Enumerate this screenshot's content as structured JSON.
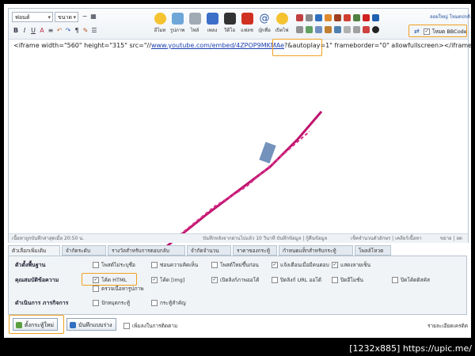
{
  "toolbar": {
    "font_select": "ฟอนต์",
    "size_select": "ขนาด",
    "big_buttons": [
      "อีโมท",
      "รูปภาพ",
      "ไฟล์",
      "เพลง",
      "วีดีโอ",
      "แฟลช",
      "@เพื่อ",
      "เปิดไฟ"
    ],
    "right_link_top": "ลอยใหญ่ โหมดปกติ",
    "bbcode_label": "โหมด BBCode"
  },
  "editor": {
    "code_prefix": "<iframe width=\"560\" height=\"315\" src=\"//",
    "code_link": "www.youtube.com/embed/4ZPOP9MKMAe",
    "code_param": "?&autoplay=1",
    "code_suffix": "\" frameborder=\"0\" allowfullscreen></iframe>",
    "status_left": "เนื้อหาถูกบันทึกล่าสุดเมื่อ 20:50 น.",
    "status_mid": "บันทึกหลังจากผ่านไปแล้ว 10 วินาที บันทึกข้อมูล | กู้คืนข้อมูล",
    "status_right": "เช็คจำนวนตัวอักษร | เคลียร์เนื้อหา",
    "status_size": "ขยาย | ลด"
  },
  "tabs": [
    "ตัวเลือกเพิ่มเติม",
    "จำกัดระดับ",
    "รางวัลสำหรับการตอบกลับ",
    "จำกัดจำนวน",
    "ราคาของกระทู้",
    "กำหนดแท็กสำหรับกระทู้",
    "โพลล์โหวต"
  ],
  "options": {
    "row1_label": "ตัวตั้งพื้นฐาน",
    "row1": [
      "โพสต์ไม่ระบุชื่อ",
      "ซ่อนความคิดเห็น",
      "โพสต์ใหม่ขึ้นก่อน",
      "แจ้งเตือนเมื่อมีคนตอบ",
      "แสดงลายเซ็น"
    ],
    "row2_label": "คุณสมบัติข้อความ",
    "row2": [
      "โค้ด HTML",
      "โค้ด [img]",
      "เปิดลิงก์ภาพออโต้",
      "ปิดลิงก์ URL ออโต้",
      "ปิดอีโมชั่น",
      "ปิดโค้ดดิสคัส"
    ],
    "row2_extra": "ตรวจเนื้อหารูปภาพ",
    "row3_label": "ดำเนินการ ภารกิจการ",
    "row3": [
      "ปักหมุดกระทู้",
      "กระทู้สำคัญ"
    ]
  },
  "footer": {
    "post_button": "ตั้งกระทู้ใหม่",
    "draft_button": "บันทึกแบบร่าง",
    "follow_label": "เพิ่มลงในการติดตาม",
    "right_link": "รายละเอียดเครดิต"
  },
  "watermark": "[1232x885] https://upic.me/",
  "colors": {
    "highlight": "#f0a020",
    "link": "#1a3fb0",
    "scribble": "#c0146e"
  }
}
